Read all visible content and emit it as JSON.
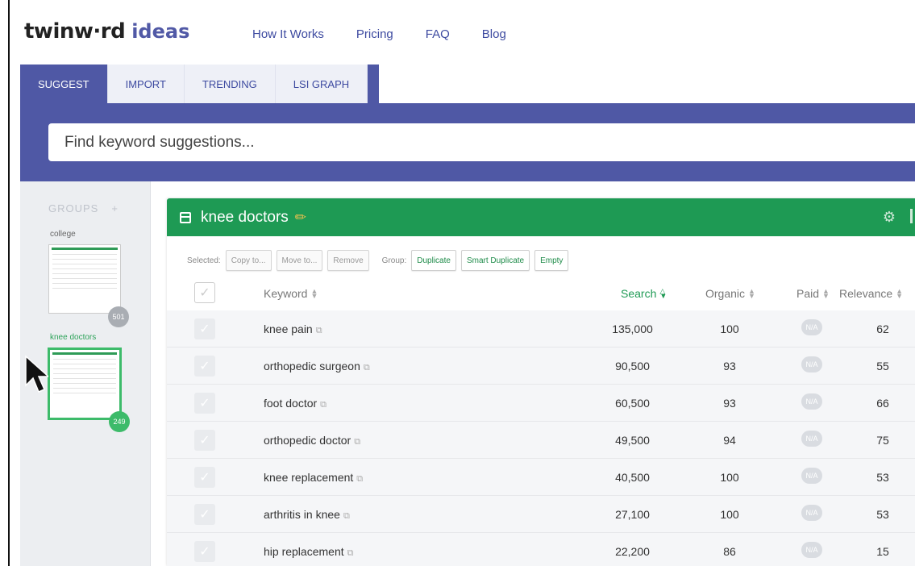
{
  "header": {
    "logo_main": "twinw·rd",
    "logo_ideas": "ideas",
    "nav": [
      "How It Works",
      "Pricing",
      "FAQ",
      "Blog"
    ]
  },
  "tabs": [
    "SUGGEST",
    "IMPORT",
    "TRENDING",
    "LSI GRAPH"
  ],
  "active_tab": "SUGGEST",
  "search": {
    "placeholder": "Find keyword suggestions..."
  },
  "sidebar": {
    "heading": "GROUPS",
    "add_symbol": "+",
    "groups": [
      {
        "name": "college",
        "count": "501",
        "active": false
      },
      {
        "name": "knee doctors",
        "count": "249",
        "active": true
      }
    ]
  },
  "panel": {
    "title": "knee doctors",
    "toolbar": {
      "selected_label": "Selected:",
      "copy_to": "Copy to...",
      "move_to": "Move to...",
      "remove": "Remove",
      "group_label": "Group:",
      "duplicate": "Duplicate",
      "smart_duplicate": "Smart Duplicate",
      "empty": "Empty"
    },
    "columns": {
      "keyword": "Keyword",
      "search": "Search",
      "organic": "Organic",
      "paid": "Paid",
      "relevance": "Relevance"
    },
    "rows": [
      {
        "keyword": "knee pain",
        "search": "135,000",
        "organic": "100",
        "paid": "N/A",
        "relevance": "62"
      },
      {
        "keyword": "orthopedic surgeon",
        "search": "90,500",
        "organic": "93",
        "paid": "N/A",
        "relevance": "55"
      },
      {
        "keyword": "foot doctor",
        "search": "60,500",
        "organic": "93",
        "paid": "N/A",
        "relevance": "66"
      },
      {
        "keyword": "orthopedic doctor",
        "search": "49,500",
        "organic": "94",
        "paid": "N/A",
        "relevance": "75"
      },
      {
        "keyword": "knee replacement",
        "search": "40,500",
        "organic": "100",
        "paid": "N/A",
        "relevance": "53"
      },
      {
        "keyword": "arthritis in knee",
        "search": "27,100",
        "organic": "100",
        "paid": "N/A",
        "relevance": "53"
      },
      {
        "keyword": "hip replacement",
        "search": "22,200",
        "organic": "86",
        "paid": "N/A",
        "relevance": "15"
      }
    ]
  },
  "colors": {
    "brand_blue": "#4f58a5",
    "nav_link": "#3d4aa0",
    "group_green": "#1e9a54",
    "badge_gray": "#a9adb3",
    "badge_green": "#3dbb6a"
  }
}
